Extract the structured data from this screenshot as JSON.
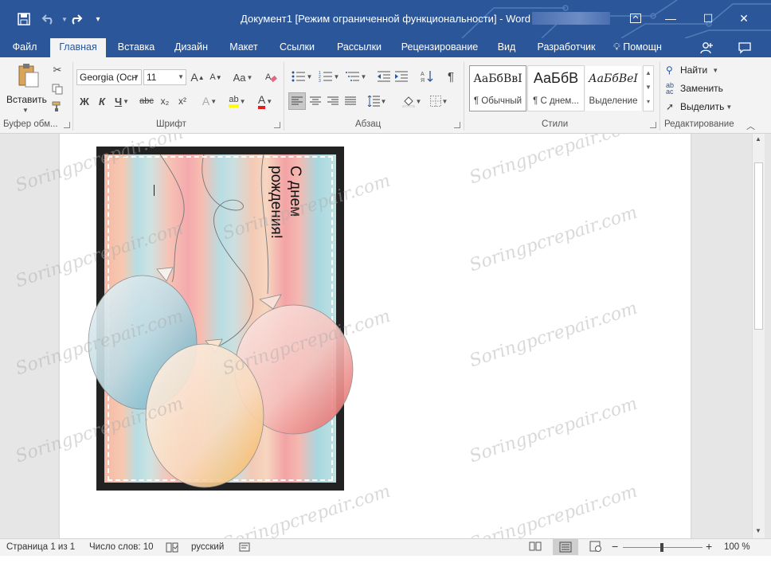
{
  "titlebar": {
    "title": "Документ1 [Режим ограниченной функциональности] - Word",
    "save_icon": "save-icon",
    "undo_icon": "undo-icon",
    "redo_icon": "redo-icon",
    "customize_icon": "customize-qat-icon",
    "ribbon_display_icon": "ribbon-display-options-icon",
    "minimize_glyph": "—",
    "maximize_glyph": "☐",
    "close_glyph": "✕"
  },
  "tabs": [
    {
      "label": "Файл"
    },
    {
      "label": "Главная"
    },
    {
      "label": "Вставка"
    },
    {
      "label": "Дизайн"
    },
    {
      "label": "Макет"
    },
    {
      "label": "Ссылки"
    },
    {
      "label": "Рассылки"
    },
    {
      "label": "Рецензирование"
    },
    {
      "label": "Вид"
    },
    {
      "label": "Разработчик"
    }
  ],
  "help": {
    "label": "Помощн"
  },
  "ribbon": {
    "clipboard": {
      "label": "Буфер обм...",
      "paste_label": "Вставить"
    },
    "font": {
      "label": "Шрифт",
      "font_name": "Georgia (Осн",
      "font_size": "11",
      "bold": "Ж",
      "italic": "К",
      "underline": "Ч",
      "strike": "abc",
      "subscript": "x₂",
      "superscript": "x²",
      "grow": "A",
      "shrink": "A",
      "case": "Aa",
      "text_effects": "A",
      "highlight": "ab",
      "font_color": "A"
    },
    "paragraph": {
      "label": "Абзац",
      "pilcrow": "¶"
    },
    "styles": {
      "label": "Стили",
      "items": [
        {
          "sample": "АаБбВвІ",
          "name": "¶ Обычный"
        },
        {
          "sample": "АаБбВ",
          "name": "¶ С днем..."
        },
        {
          "sample": "АаБбВеІ",
          "name": "Выделение"
        }
      ]
    },
    "editing": {
      "label": "Редактирование",
      "find": "Найти",
      "replace": "Заменить",
      "select": "Выделить"
    }
  },
  "document": {
    "card_text_line1": "С днем",
    "card_text_line2": "рождения!",
    "watermark": "Soringpcrepair.com"
  },
  "status": {
    "page": "Страница 1 из 1",
    "words": "Число слов: 10",
    "language": "русский",
    "zoom": "100 %",
    "zoom_minus": "−",
    "zoom_plus": "+",
    "zoom_level_percent": 100
  },
  "colors": {
    "accent": "#2b579a",
    "ribbon_bg": "#f3f3f3",
    "doc_bg": "#e6e6e6"
  }
}
